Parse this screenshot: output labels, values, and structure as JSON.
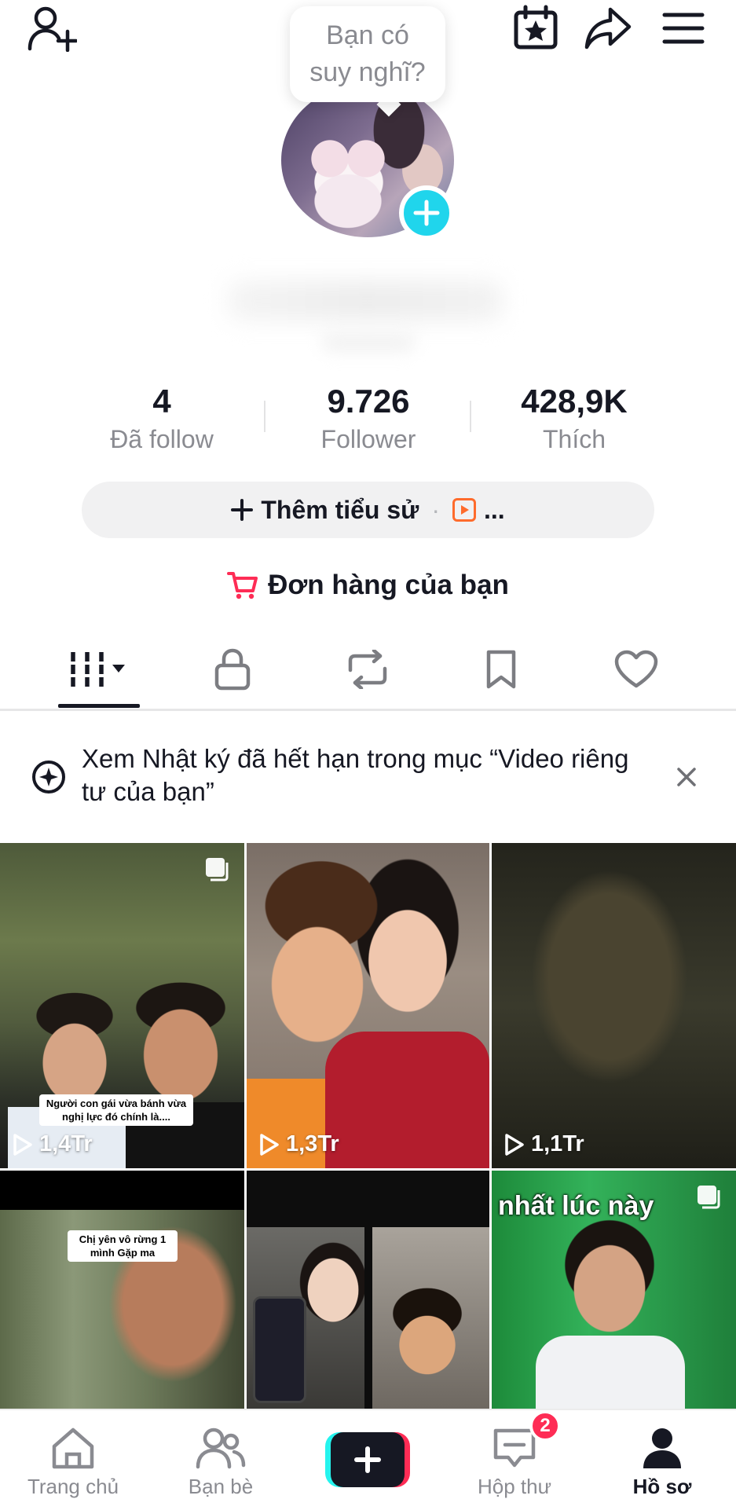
{
  "top_bar": {
    "left_icon": "add-user-icon",
    "right_icons": [
      "calendar-star-icon",
      "share-icon",
      "menu-icon"
    ],
    "prompt_bubble": {
      "line1": "Bạn có",
      "line2": "suy nghĩ?"
    }
  },
  "stats": [
    {
      "value": "4",
      "label": "Đã follow"
    },
    {
      "value": "9.726",
      "label": "Follower"
    },
    {
      "value": "428,9K",
      "label": "Thích"
    }
  ],
  "bio_button": {
    "label": "Thêm tiểu sử",
    "separator": "·",
    "trailing": "..."
  },
  "orders": {
    "label": "Đơn hàng của bạn",
    "icon": "cart-icon"
  },
  "tabs": [
    {
      "name": "videos",
      "icon": "grid-icon",
      "active": true
    },
    {
      "name": "private",
      "icon": "lock-icon"
    },
    {
      "name": "reposts",
      "icon": "repost-icon"
    },
    {
      "name": "saved",
      "icon": "bookmark-icon"
    },
    {
      "name": "liked",
      "icon": "heart-icon"
    }
  ],
  "notice": {
    "text": "Xem Nhật ký đã hết hạn trong mục “Video riêng tư của bạn”",
    "icon": "sparkle-icon"
  },
  "videos": [
    {
      "views": "1,4Tr",
      "caption": "Người con gái vừa bánh vừa nghị lực đó chính là....",
      "multi": true
    },
    {
      "views": "1,3Tr"
    },
    {
      "views": "1,1Tr"
    },
    {
      "caption": "Chị yên vô rừng 1 mình Gặp ma"
    },
    {},
    {
      "overlay_text": "nhất lúc này",
      "multi": true
    }
  ],
  "bottom_nav": [
    {
      "label": "Trang chủ",
      "icon": "home-icon"
    },
    {
      "label": "Bạn bè",
      "icon": "friends-icon"
    },
    {
      "label": "",
      "icon": "plus-icon"
    },
    {
      "label": "Hộp thư",
      "icon": "inbox-icon",
      "badge": "2"
    },
    {
      "label": "Hồ sơ",
      "icon": "profile-icon",
      "active": true
    }
  ],
  "colors": {
    "accent": "#fe2c55",
    "cyan": "#20d5ec",
    "orange": "#fe6b2c"
  }
}
